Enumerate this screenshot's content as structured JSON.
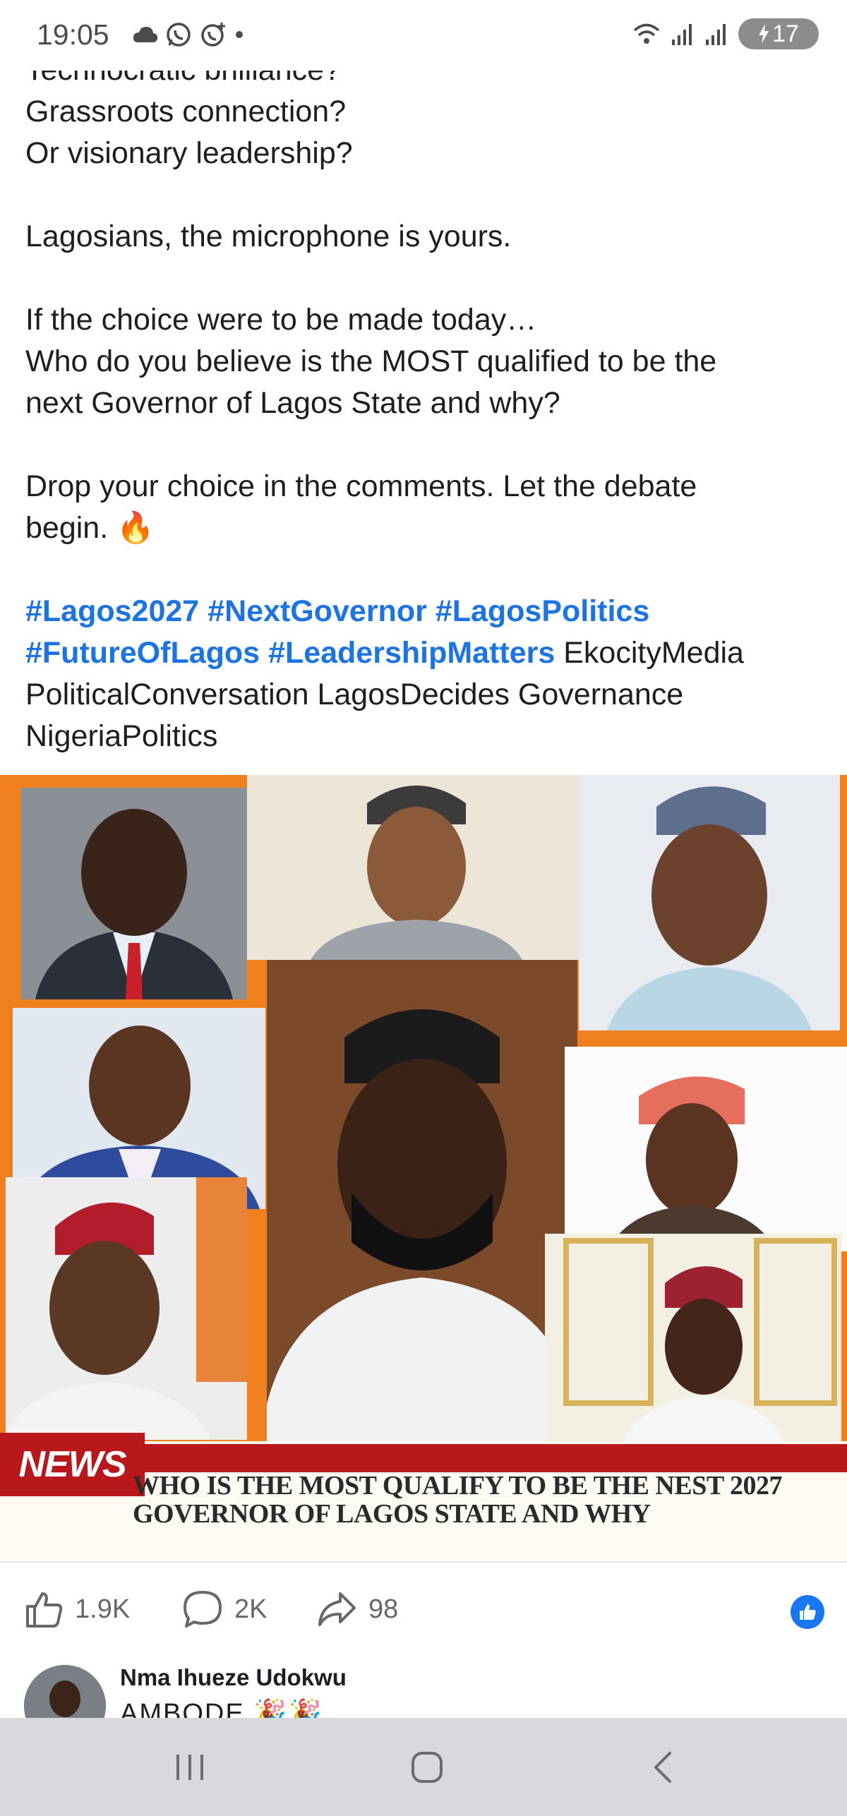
{
  "status_bar": {
    "time": "19:05",
    "left_icons": [
      "cloud-icon",
      "whatsapp-icon",
      "whatsapp-business-icon",
      "dot-icon"
    ],
    "right_icons": [
      "wifi-icon",
      "signal-icon",
      "signal-icon-2"
    ],
    "battery_level": "17"
  },
  "post": {
    "lines": [
      "Technocratic brilliance?",
      "Grassroots connection?",
      "Or visionary leadership?",
      "",
      "Lagosians, the microphone is yours.",
      "",
      "If the choice were to be made today…",
      "Who do you believe is the MOST qualified to be the",
      "next Governor of Lagos State and why?",
      "",
      "Drop your choice in the comments. Let the debate",
      "begin. 🔥",
      ""
    ],
    "hashtags_line1": [
      "#Lagos2027",
      "#NextGovernor",
      "#LagosPolitics"
    ],
    "hashtags_line2": [
      "#FutureOfLagos",
      "#LeadershipMatters"
    ],
    "tags_line2_plain": "EkocityMedia",
    "tags_line3": "PoliticalConversation LagosDecides Governance",
    "tags_line4": "NigeriaPolitics"
  },
  "media": {
    "news_tag": "NEWS",
    "headline_line1": "WHO IS THE MOST QUALIFY TO BE THE NEST 2027",
    "headline_line2": "GOVERNOR OF LAGOS STATE AND WHY",
    "accent_color": "#f07f1e",
    "banner_color": "#b8171c"
  },
  "actions": {
    "like_count": "1.9K",
    "comment_count": "2K",
    "share_count": "98"
  },
  "comment": {
    "author": "Nma Ihueze Udokwu",
    "text": "AMBODE 🎉🎉"
  },
  "nav": [
    "recent-apps-icon",
    "home-icon",
    "back-icon"
  ]
}
